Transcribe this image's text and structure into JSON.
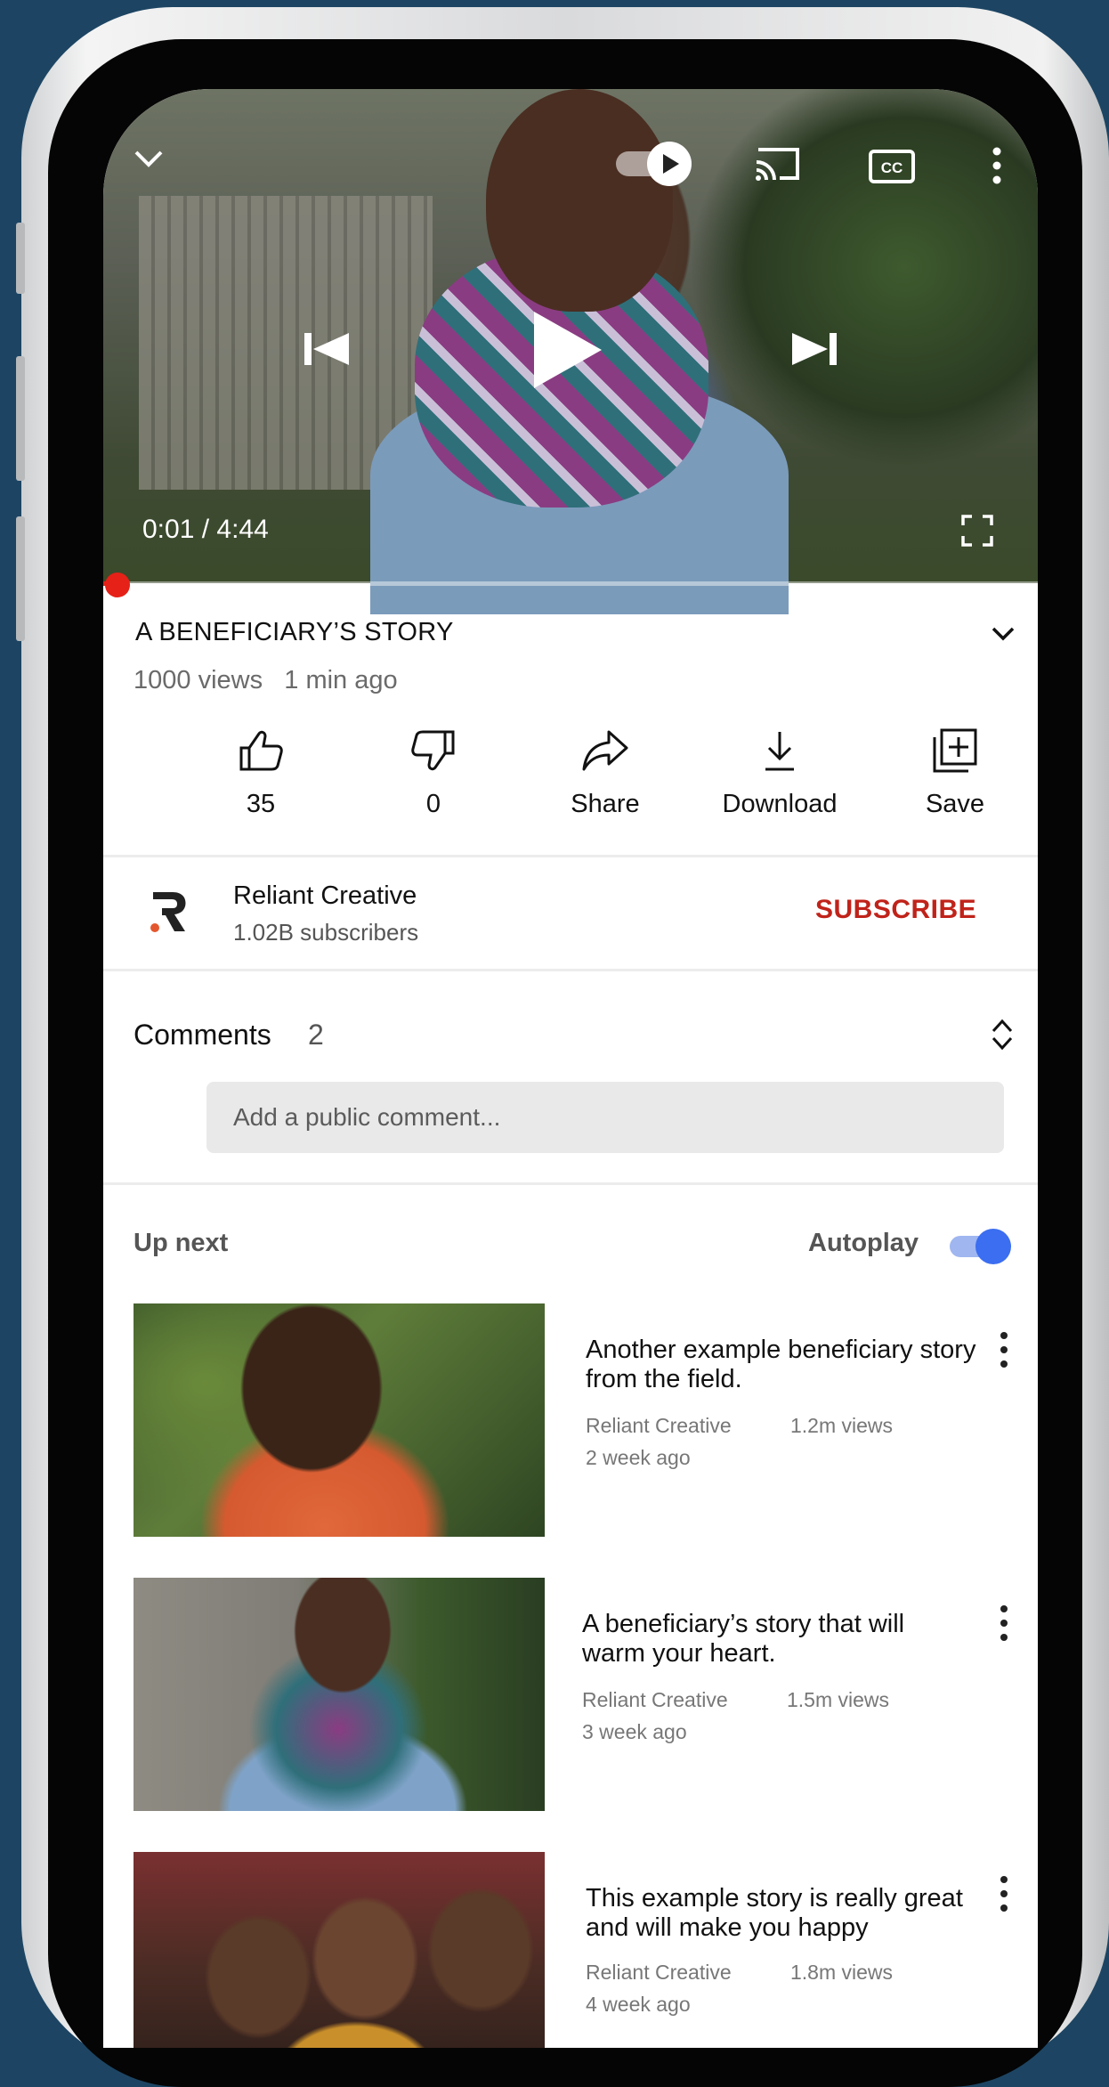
{
  "player": {
    "time": "0:01 / 4:44",
    "progress": 0.004
  },
  "video": {
    "title": "A BENEFICIARY’S STORY",
    "views": "1000 views",
    "age": "1 min ago"
  },
  "actions": {
    "like_count": "35",
    "dislike_count": "0",
    "share_label": "Share",
    "download_label": "Download",
    "save_label": "Save"
  },
  "channel": {
    "name": "Reliant Creative",
    "subscribers": "1.02B subscribers",
    "subscribe_label": "SUBSCRIBE",
    "accent_color": "#c0231a"
  },
  "comments": {
    "title": "Comments",
    "count": "2",
    "placeholder": "Add a public comment..."
  },
  "upnext": {
    "title": "Up next",
    "autoplay_label": "Autoplay",
    "autoplay_on": true,
    "items": [
      {
        "title": "Another example beneficiary story from the field.",
        "channel": "Reliant Creative",
        "views": "1.2m views",
        "age": "2 week ago"
      },
      {
        "title": "A beneficiary’s story that will warm your heart.",
        "channel": "Reliant Creative",
        "views": "1.5m views",
        "age": "3 week ago"
      },
      {
        "title": "This example story is really great and will make you happy",
        "channel": "Reliant Creative",
        "views": "1.8m views",
        "age": "4 week ago"
      }
    ]
  },
  "icons": [
    "chevron-down-icon",
    "autoplay-toggle-icon",
    "cast-icon",
    "cc-icon",
    "more-vert-icon",
    "previous-icon",
    "play-icon",
    "next-icon",
    "fullscreen-icon",
    "expand-icon",
    "thumbs-up-icon",
    "thumbs-down-icon",
    "share-icon",
    "download-icon",
    "save-icon",
    "sort-icon"
  ]
}
